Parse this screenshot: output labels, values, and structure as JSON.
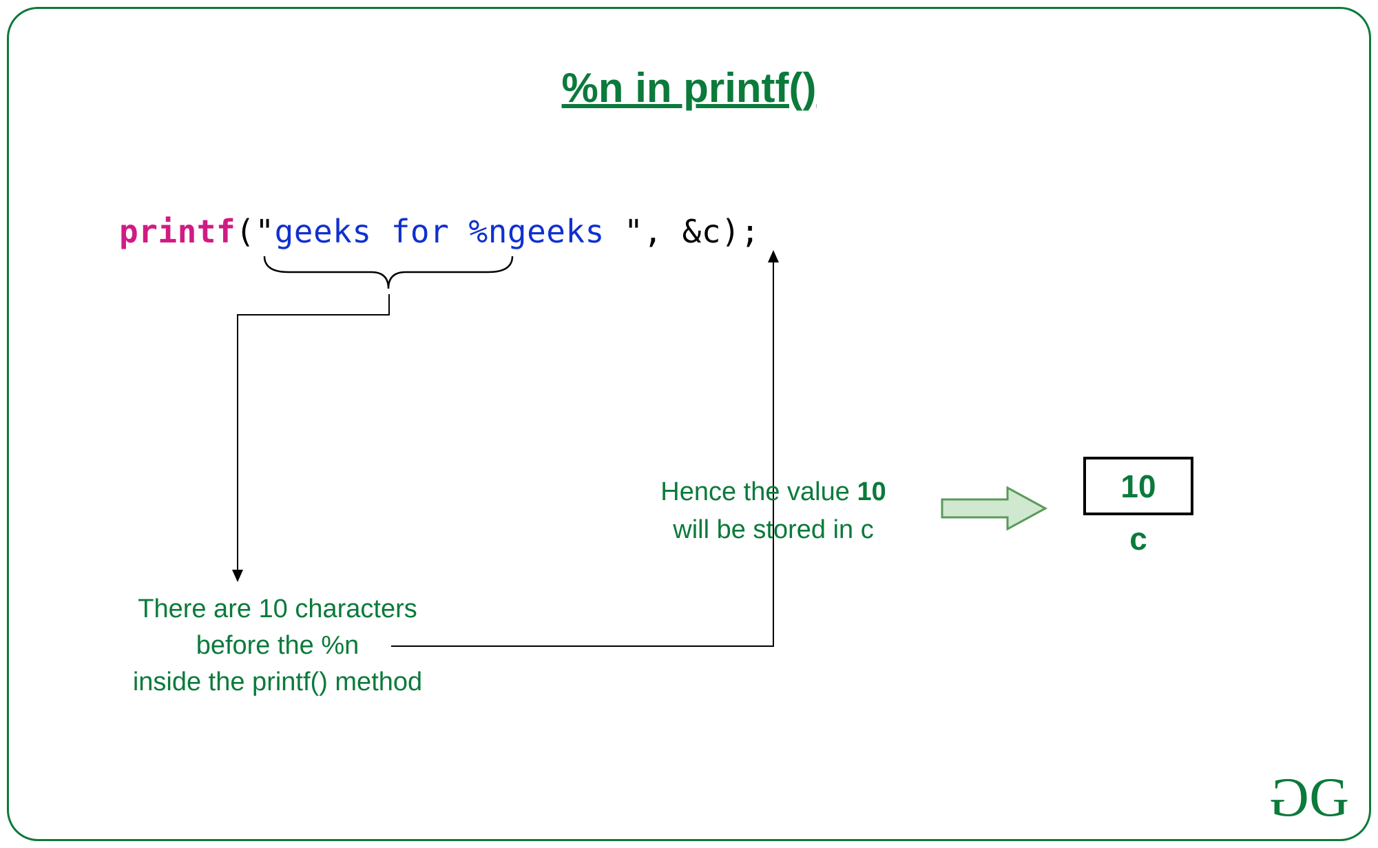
{
  "title": "%n in printf()",
  "code": {
    "keyword": "printf",
    "open": "(\"",
    "string": "geeks for %ngeeks ",
    "close": "\", ",
    "arg": "&c",
    "end": ");"
  },
  "captions": {
    "left_l1": "There are 10 characters",
    "left_l2": "before the %n",
    "left_l3": "inside the printf() method",
    "right_l1_a": "Hence the value ",
    "right_l1_b": "10",
    "right_l2": "will be stored in c"
  },
  "result": {
    "value": "10",
    "varname": "c"
  },
  "logo": {
    "g1": "G",
    "g2": "G"
  },
  "colors": {
    "brand": "#0b7a3b",
    "keyword": "#d01b84",
    "string": "#1030d0"
  }
}
